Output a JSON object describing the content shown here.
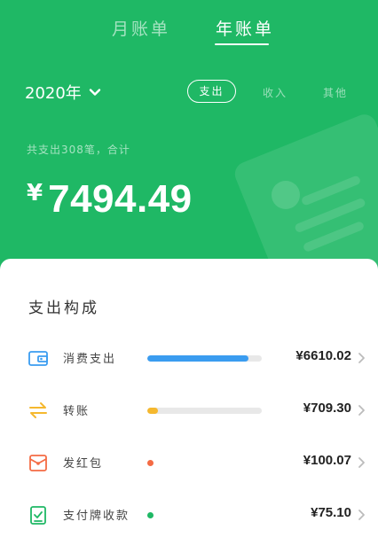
{
  "tabs": {
    "month": "月账单",
    "year": "年账单"
  },
  "year_select": {
    "label": "2020年"
  },
  "filters": {
    "expense": "支出",
    "income": "收入",
    "other": "其他"
  },
  "summary": {
    "text": "共支出308笔，合计"
  },
  "total": {
    "currency": "¥",
    "amount": "7494.49"
  },
  "composition": {
    "title": "支出构成",
    "items": [
      {
        "icon": "wallet-icon",
        "label": "消费支出",
        "value": "¥6610.02",
        "color": "#3a9cf0",
        "share": 0.882
      },
      {
        "icon": "transfer-icon",
        "label": "转账",
        "value": "¥709.30",
        "color": "#f5b82e",
        "share": 0.095
      },
      {
        "icon": "red-packet-icon",
        "label": "发红包",
        "value": "¥100.07",
        "color": "#f46b44",
        "share": 0.013
      },
      {
        "icon": "payment-code-icon",
        "label": "支付牌收款",
        "value": "¥75.10",
        "color": "#1fb865",
        "share": 0.01
      }
    ]
  },
  "colors": {
    "brand": "#1fb865",
    "panel": "#ffffff"
  }
}
